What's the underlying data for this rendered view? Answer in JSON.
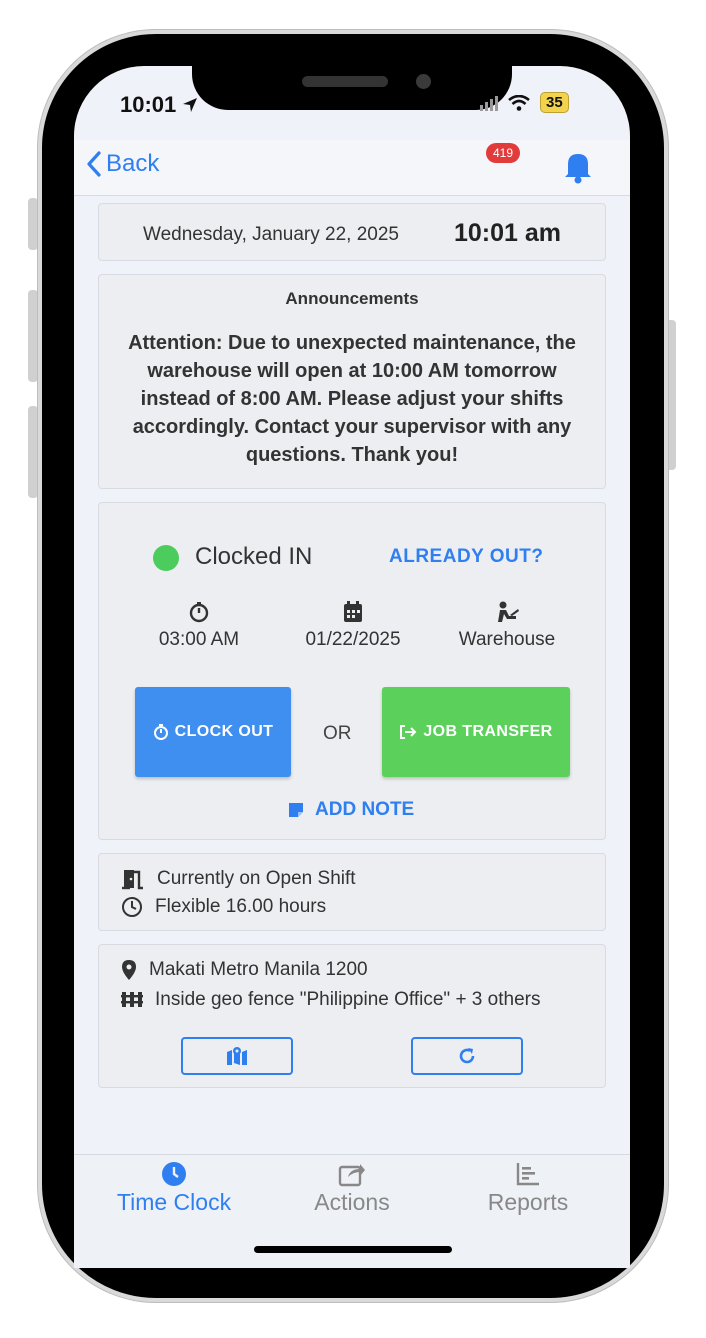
{
  "status_bar": {
    "time": "10:01",
    "battery": "35"
  },
  "nav": {
    "back_label": "Back",
    "notification_count": "419"
  },
  "datetime": {
    "date": "Wednesday, January 22, 2025",
    "time": "10:01 am"
  },
  "announcements": {
    "title": "Announcements",
    "body": "Attention: Due to unexpected maintenance, the warehouse will open at 10:00 AM tomorrow instead of 8:00 AM. Please adjust your shifts accordingly. Contact your supervisor with any questions. Thank you!"
  },
  "clock": {
    "status": "Clocked IN",
    "already_out": "ALREADY OUT?",
    "clock_in_time": "03:00 AM",
    "date": "01/22/2025",
    "job": "Warehouse",
    "clock_out_label": "CLOCK OUT",
    "or_label": "OR",
    "job_transfer_label": "JOB TRANSFER",
    "add_note_label": "ADD NOTE"
  },
  "shift": {
    "shift_text": "Currently on Open Shift",
    "hours_text": "Flexible 16.00 hours"
  },
  "location": {
    "address": "Makati Metro Manila 1200",
    "geofence": "Inside geo fence \"Philippine Office\" + 3 others"
  },
  "tabs": [
    {
      "label": "Time Clock",
      "active": true
    },
    {
      "label": "Actions",
      "active": false
    },
    {
      "label": "Reports",
      "active": false
    }
  ],
  "colors": {
    "accent": "#2f7ff0",
    "clock_out": "#3f8ff0",
    "job_transfer": "#5bd15b",
    "status_in": "#4ccc5c",
    "badge": "#e23b3b"
  }
}
